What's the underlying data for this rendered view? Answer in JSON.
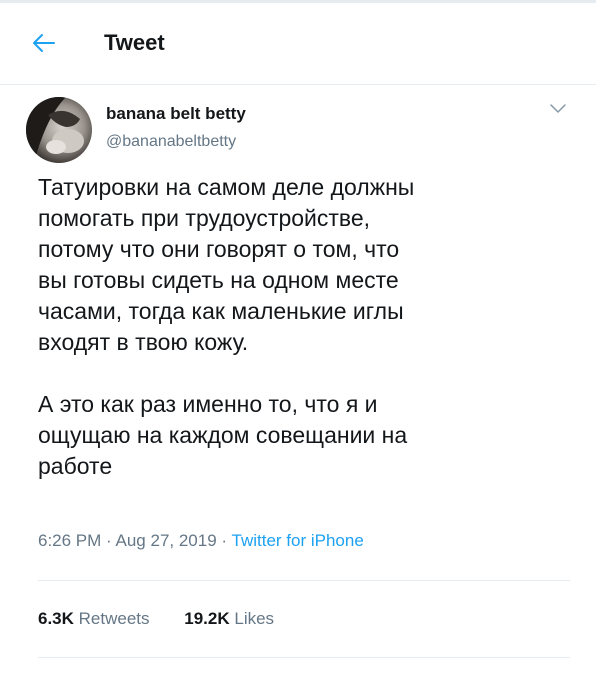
{
  "header": {
    "title": "Tweet",
    "back_icon": "arrow-left-icon"
  },
  "tweet": {
    "author": {
      "display_name": "banana belt betty",
      "handle": "@bananabeltbetty",
      "avatar_icon": "avatar-photo"
    },
    "menu_icon": "chevron-down-icon",
    "paragraphs": [
      "Татуировки на самом деле должны\nпомогать при трудоустройстве,\nпотому что они говорят о том, что\nвы готовы сидеть на одном месте\nчасами, тогда как маленькие иглы\nвходят в твою кожу.",
      "А это как раз именно то, что я и\nощущаю на каждом совещании на\nработе"
    ],
    "time": "6:26 PM",
    "date": "Aug 27, 2019",
    "separator": "·",
    "source": "Twitter for iPhone"
  },
  "stats": {
    "retweets_count": "6.3K",
    "retweets_label": "Retweets",
    "likes_count": "19.2K",
    "likes_label": "Likes"
  },
  "colors": {
    "link_blue": "#1da1f2",
    "secondary_text": "#657786",
    "divider": "#e6ecf0",
    "text": "#14171a"
  }
}
